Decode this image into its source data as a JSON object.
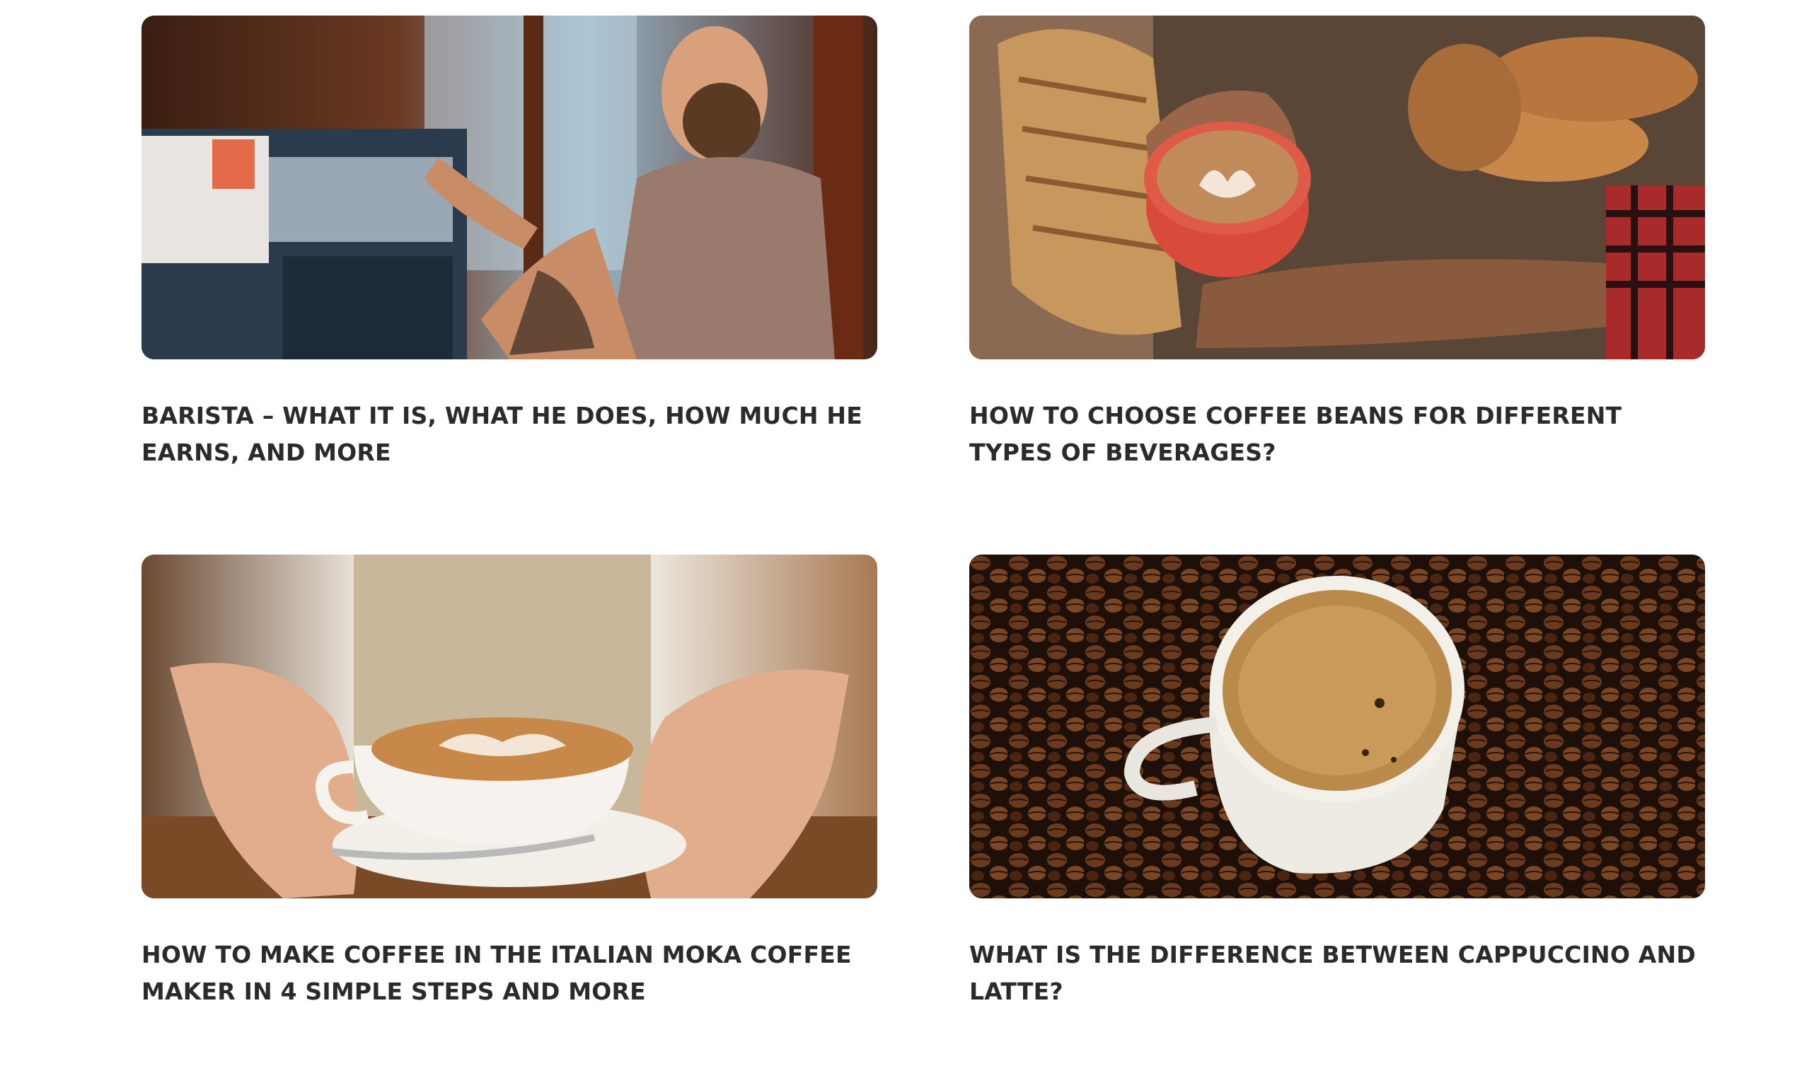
{
  "articles": [
    {
      "title": "BARISTA – WHAT IT IS, WHAT HE DOES, HOW MUCH HE EARNS, AND MORE",
      "image": "barista-at-espresso-machine"
    },
    {
      "title": "HOW TO CHOOSE COFFEE BEANS FOR DIFFERENT TYPES OF BEVERAGES?",
      "image": "latte-cup-with-bread"
    },
    {
      "title": "HOW TO MAKE COFFEE IN THE ITALIAN MOKA COFFEE MAKER IN 4 SIMPLE STEPS AND MORE",
      "image": "cappuccino-cup-on-saucer"
    },
    {
      "title": "WHAT IS THE DIFFERENCE BETWEEN CAPPUCCINO AND LATTE?",
      "image": "coffee-cup-on-beans"
    }
  ]
}
